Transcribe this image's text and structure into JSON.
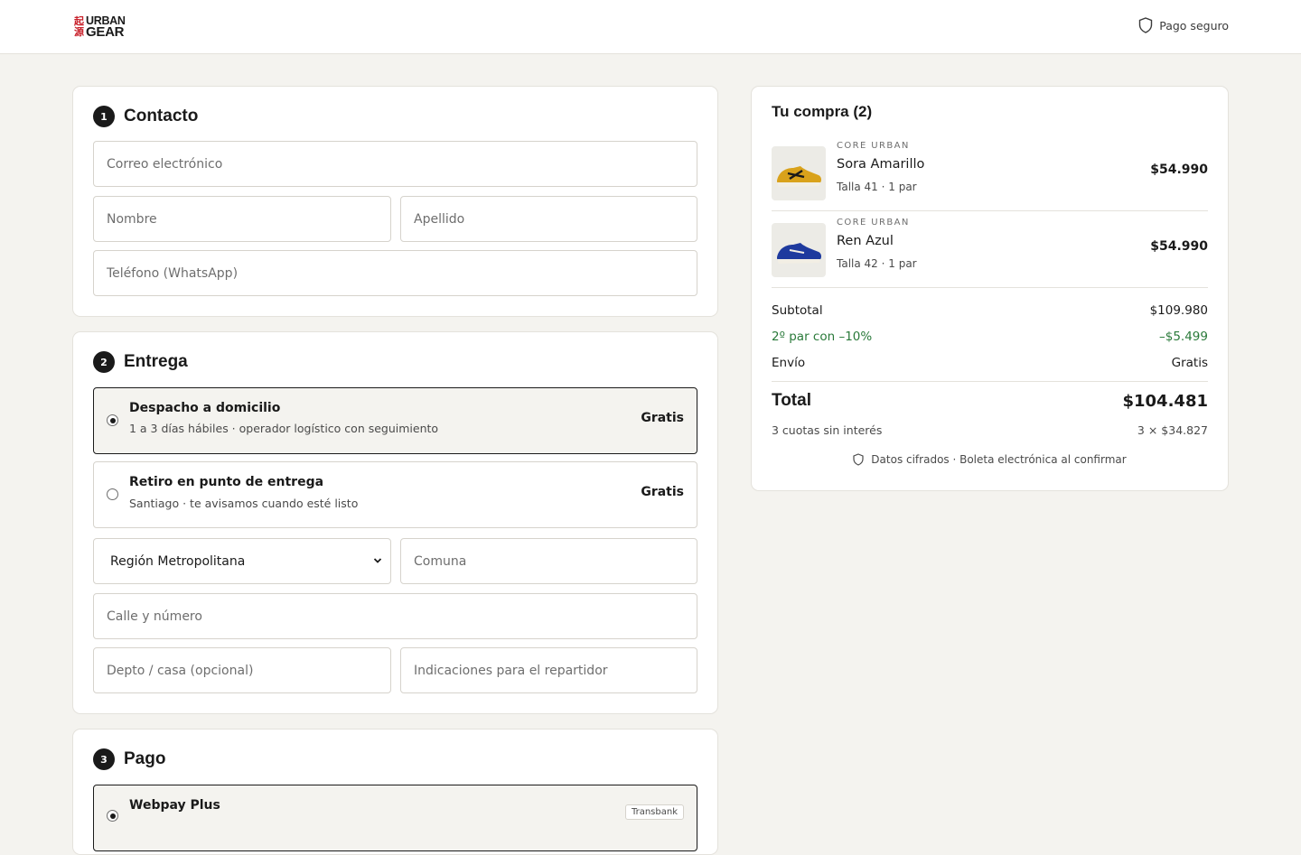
{
  "header": {
    "logo_kanji": [
      "起",
      "源"
    ],
    "logo_lines": [
      "URBAN",
      "GEAR"
    ],
    "secure_label": "Pago seguro"
  },
  "contact": {
    "step": "1",
    "title": "Contacto",
    "email_placeholder": "Correo electrónico",
    "first_name_placeholder": "Nombre",
    "last_name_placeholder": "Apellido",
    "phone_placeholder": "Teléfono (WhatsApp)"
  },
  "delivery": {
    "step": "2",
    "title": "Entrega",
    "options": [
      {
        "title": "Despacho a domicilio",
        "subtitle": "1 a 3 días hábiles · operador logístico con seguimiento",
        "price": "Gratis",
        "selected": true
      },
      {
        "title": "Retiro en punto de entrega",
        "subtitle": "Santiago · te avisamos cuando esté listo",
        "price": "Gratis",
        "selected": false
      }
    ],
    "region_value": "Región Metropolitana",
    "comuna_placeholder": "Comuna",
    "street_placeholder": "Calle y número",
    "apt_placeholder": "Depto / casa (opcional)",
    "notes_placeholder": "Indicaciones para el repartidor"
  },
  "payment": {
    "step": "3",
    "title": "Pago",
    "option_title": "Webpay Plus",
    "option_badge": "Transbank"
  },
  "summary": {
    "title": "Tu compra (2)",
    "items": [
      {
        "brand": "CORE URBAN",
        "name": "Sora Amarillo",
        "meta": "Talla 41 · 1 par",
        "price": "$54.990",
        "color": "#d9a21b"
      },
      {
        "brand": "CORE URBAN",
        "name": "Ren Azul",
        "meta": "Talla 42 · 1 par",
        "price": "$54.990",
        "color": "#1e3a9e"
      }
    ],
    "subtotal_label": "Subtotal",
    "subtotal_value": "$109.980",
    "discount_label": "2º par con –10%",
    "discount_value": "–$5.499",
    "shipping_label": "Envío",
    "shipping_value": "Gratis",
    "total_label": "Total",
    "total_value": "$104.481",
    "installments_label": "3 cuotas sin interés",
    "installments_value": "3 × $34.827",
    "secure_note": "Datos cifrados · Boleta electrónica al confirmar",
    "accent_green": "#2a7a3a"
  }
}
